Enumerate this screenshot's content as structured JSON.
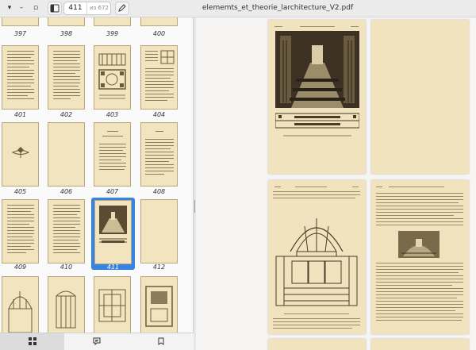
{
  "window": {
    "title": "elememts_et_theorie_larchitecture_V2.pdf",
    "minimize_glyph": "–",
    "maximize_glyph": "▫",
    "sidebar_toggle_icon": "sidebar-icon",
    "edit_icon": "pencil-icon"
  },
  "pager": {
    "current": "411",
    "total": "из 672"
  },
  "thumbnails": {
    "row0": [
      "397",
      "398",
      "399",
      "400"
    ],
    "row1": [
      "401",
      "402",
      "403",
      "404"
    ],
    "row2": [
      "405",
      "406",
      "407",
      "408"
    ],
    "row3": [
      "409",
      "410",
      "411",
      "412"
    ],
    "selected": "411"
  },
  "bottom_tabs": [
    {
      "icon": "grid-icon",
      "active": true
    },
    {
      "icon": "annotations-icon",
      "active": false
    },
    {
      "icon": "bookmark-icon",
      "active": false
    }
  ],
  "colors": {
    "accent": "#3584e4",
    "paper": "#f0e3bd"
  }
}
